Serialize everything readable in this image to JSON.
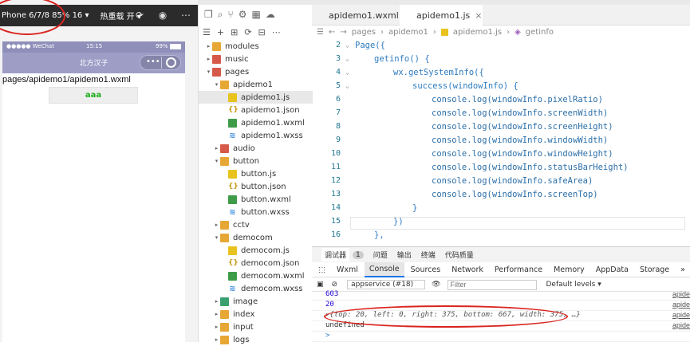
{
  "toolbar": {
    "device_label": "Phone 6/7/8 85% 16 ▾",
    "hotreload_label": "热重载 开 ▾"
  },
  "phone": {
    "status_carrier": "●●●●● WeChat",
    "status_time": "15:15",
    "status_battery": "99%",
    "nav_title": "北方汉子",
    "page_path": "pages/apidemo1/apidemo1.wxml",
    "button_label": "aaa"
  },
  "explorer": {
    "items": [
      {
        "label": "modules",
        "type": "folder",
        "color": "#e7a735",
        "indent": 0,
        "caret": "▸"
      },
      {
        "label": "music",
        "type": "folder",
        "color": "#d65a4a",
        "indent": 0,
        "caret": "▸"
      },
      {
        "label": "pages",
        "type": "folder",
        "color": "#d65a4a",
        "indent": 0,
        "caret": "▾"
      },
      {
        "label": "apidemo1",
        "type": "folder",
        "color": "#e7a735",
        "indent": 1,
        "caret": "▾"
      },
      {
        "label": "apidemo1.js",
        "type": "js",
        "indent": 2,
        "selected": true
      },
      {
        "label": "apidemo1.json",
        "type": "json",
        "indent": 2
      },
      {
        "label": "apidemo1.wxml",
        "type": "wxml",
        "indent": 2
      },
      {
        "label": "apidemo1.wxss",
        "type": "wxss",
        "indent": 2
      },
      {
        "label": "audio",
        "type": "folder",
        "color": "#d65a4a",
        "indent": 1,
        "caret": "▸"
      },
      {
        "label": "button",
        "type": "folder",
        "color": "#e7a735",
        "indent": 1,
        "caret": "▾"
      },
      {
        "label": "button.js",
        "type": "js",
        "indent": 2
      },
      {
        "label": "button.json",
        "type": "json",
        "indent": 2
      },
      {
        "label": "button.wxml",
        "type": "wxml",
        "indent": 2
      },
      {
        "label": "button.wxss",
        "type": "wxss",
        "indent": 2
      },
      {
        "label": "cctv",
        "type": "folder",
        "color": "#e7a735",
        "indent": 1,
        "caret": "▸"
      },
      {
        "label": "democom",
        "type": "folder",
        "color": "#e7a735",
        "indent": 1,
        "caret": "▾"
      },
      {
        "label": "democom.js",
        "type": "js",
        "indent": 2
      },
      {
        "label": "democom.json",
        "type": "json",
        "indent": 2
      },
      {
        "label": "democom.wxml",
        "type": "wxml",
        "indent": 2
      },
      {
        "label": "democom.wxss",
        "type": "wxss",
        "indent": 2
      },
      {
        "label": "image",
        "type": "folder",
        "color": "#3aa06f",
        "indent": 1,
        "caret": "▸"
      },
      {
        "label": "index",
        "type": "folder",
        "color": "#e7a735",
        "indent": 1,
        "caret": "▸"
      },
      {
        "label": "input",
        "type": "folder",
        "color": "#e7a735",
        "indent": 1,
        "caret": "▸"
      },
      {
        "label": "logs",
        "type": "folder",
        "color": "#e7a735",
        "indent": 1,
        "caret": "▸"
      }
    ]
  },
  "editor": {
    "tabs": [
      {
        "label": "apidemo1.wxml",
        "active": false
      },
      {
        "label": "apidemo1.js",
        "active": true
      }
    ],
    "breadcrumb": [
      "pages",
      "apidemo1",
      "apidemo1.js",
      "getinfo"
    ],
    "lines": [
      {
        "num": "2",
        "text": "Page({",
        "indent": 0
      },
      {
        "num": "3",
        "text": "getinfo() {",
        "indent": 1
      },
      {
        "num": "4",
        "text": "wx.getSystemInfo({",
        "indent": 2
      },
      {
        "num": "5",
        "text": "success(windowInfo) {",
        "indent": 3
      },
      {
        "num": "6",
        "text": "console.log(windowInfo.pixelRatio)",
        "indent": 4
      },
      {
        "num": "7",
        "text": "console.log(windowInfo.screenWidth)",
        "indent": 4
      },
      {
        "num": "8",
        "text": "console.log(windowInfo.screenHeight)",
        "indent": 4
      },
      {
        "num": "9",
        "text": "console.log(windowInfo.windowWidth)",
        "indent": 4
      },
      {
        "num": "10",
        "text": "console.log(windowInfo.windowHeight)",
        "indent": 4
      },
      {
        "num": "11",
        "text": "console.log(windowInfo.statusBarHeight)",
        "indent": 4
      },
      {
        "num": "12",
        "text": "console.log(windowInfo.safeArea)",
        "indent": 4
      },
      {
        "num": "13",
        "text": "console.log(windowInfo.screenTop)",
        "indent": 4
      },
      {
        "num": "14",
        "text": "}",
        "indent": 3
      },
      {
        "num": "15",
        "text": "})",
        "indent": 2
      },
      {
        "num": "16",
        "text": "},",
        "indent": 1
      }
    ]
  },
  "devtools": {
    "top_tabs": [
      "调试器",
      "1",
      "问题",
      "输出",
      "终端",
      "代码质量"
    ],
    "panel_tabs": [
      "Wxml",
      "Console",
      "Sources",
      "Network",
      "Performance",
      "Memory",
      "AppData",
      "Storage",
      "»"
    ],
    "context_select": "appservice (#18)",
    "filter_placeholder": "Filter",
    "levels_select": "Default levels ▾",
    "logs": [
      {
        "text": "603",
        "color": "#1c00cf",
        "source": "apide"
      },
      {
        "text": "20",
        "color": "#1c00cf",
        "source": "apide"
      },
      {
        "text": "▸{top: 20, left: 0, right: 375, bottom: 667, width: 375, …}",
        "color": "#555",
        "source": "apide"
      },
      {
        "text": "undefined",
        "color": "#333",
        "source": "apide"
      },
      {
        "text": ">",
        "color": "#2d7bbf",
        "source": ""
      }
    ]
  }
}
